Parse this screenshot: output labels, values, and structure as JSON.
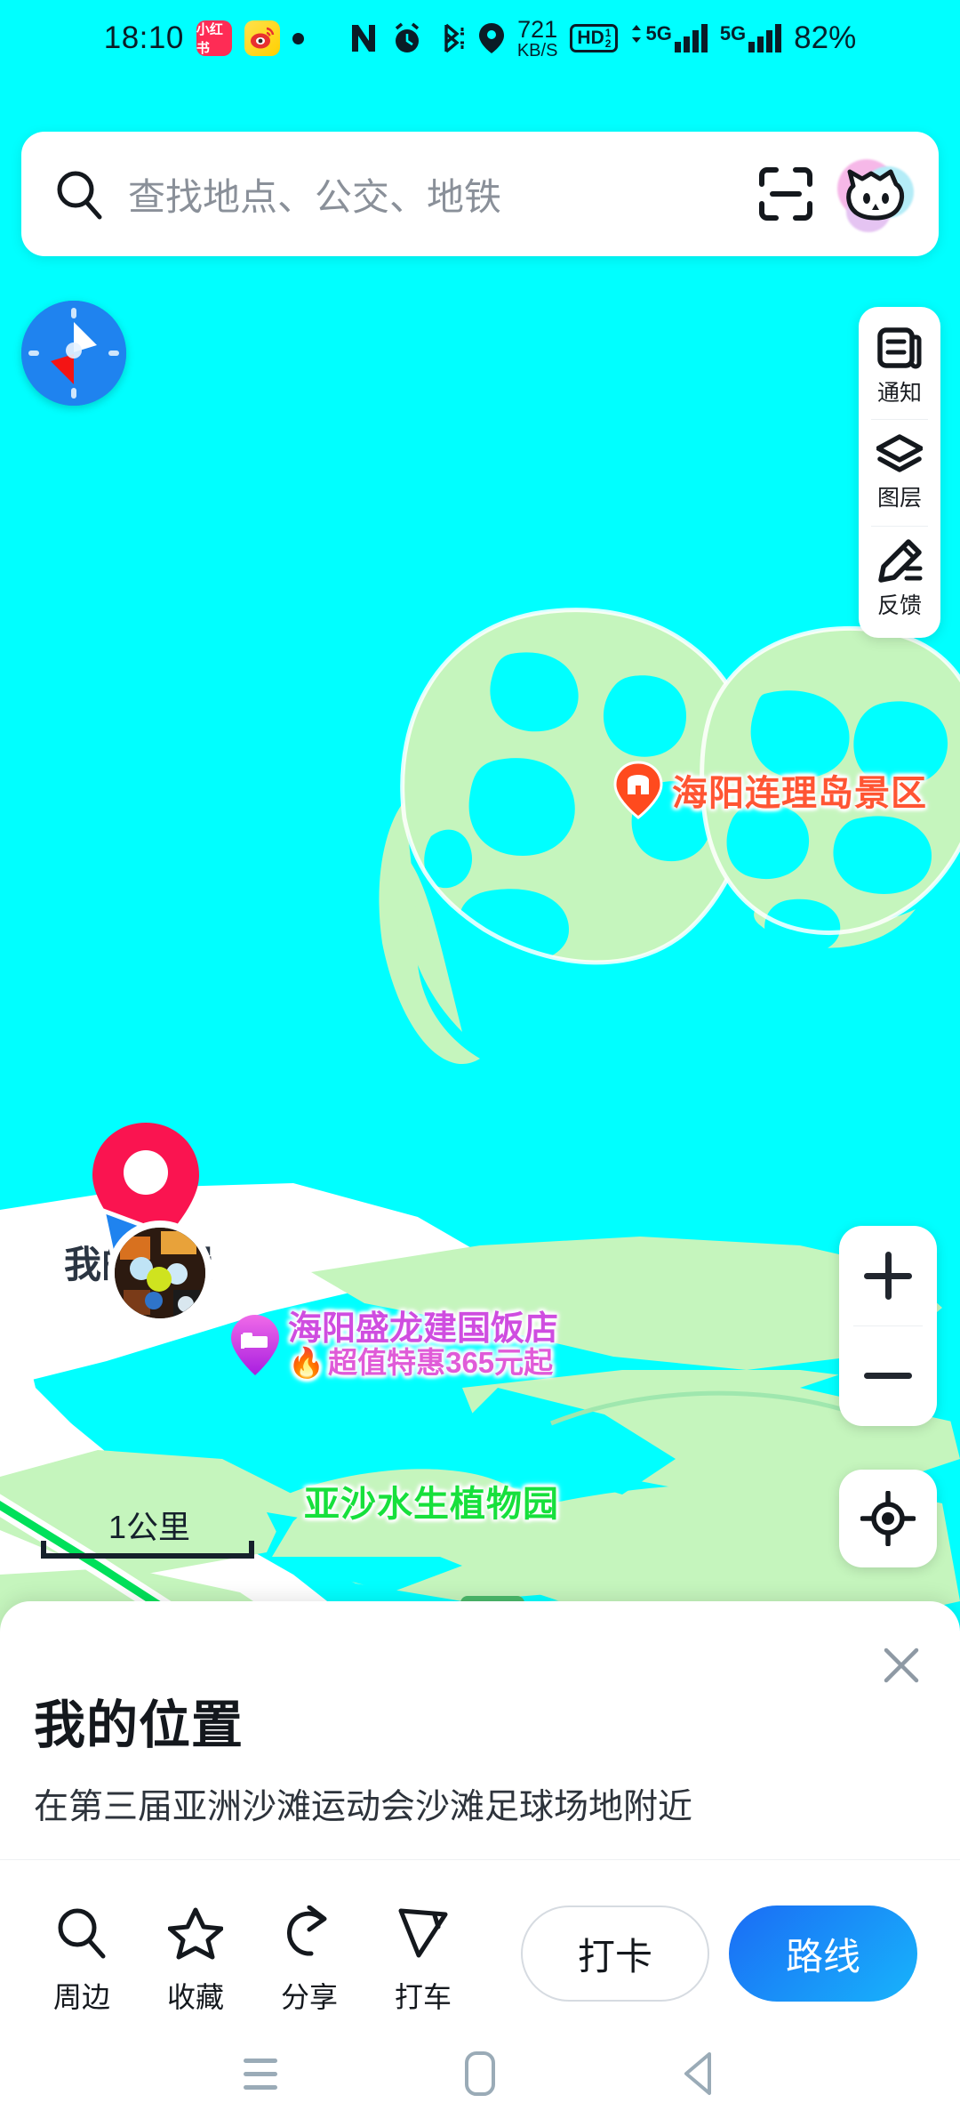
{
  "status_bar": {
    "time": "18:10",
    "app_icons": [
      {
        "name": "xiaohongshu-icon",
        "label": "小红书"
      },
      {
        "name": "weibo-icon",
        "label": "微博"
      }
    ],
    "indicators": [
      {
        "name": "nfc-icon",
        "label": "NFC"
      },
      {
        "name": "alarm-icon",
        "label": "闹钟"
      },
      {
        "name": "bluetooth-icon",
        "label": "蓝牙"
      },
      {
        "name": "location-icon",
        "label": "定位"
      }
    ],
    "network_speed_value": "721",
    "network_speed_unit": "KB/S",
    "hd_label": "HD",
    "hd_sup_top": "1",
    "hd_sup_bottom": "2",
    "sim1_network": "5G",
    "sim2_network": "5G",
    "battery": "82%"
  },
  "search": {
    "placeholder": "查找地点、公交、地铁",
    "value": "",
    "scan_icon": "scan-icon",
    "avatar_icon": "cat-avatar-icon"
  },
  "map": {
    "compass_icon": "compass-icon",
    "scale_label": "1公里",
    "labels": {
      "scenic_spot": "海阳连理岛景区",
      "park": "亚沙水生植物园",
      "hotel_name": "海阳盛龙建国饭店",
      "hotel_promo": "超值特惠365元起",
      "hotel_promo_icon": "fire-icon",
      "my_position": "我的位置"
    },
    "colors": {
      "water": "#00ffff",
      "land": "#c5f5bd",
      "road_green": "#00e05a",
      "road_white": "#ffffff",
      "scenic_label": "#ff5533",
      "park_label": "#17e03c",
      "hotel_label": "#cf4de0",
      "my_pin": "#fa1450"
    }
  },
  "tool_rail": [
    {
      "icon": "notification-icon",
      "label": "通知"
    },
    {
      "icon": "layers-icon",
      "label": "图层"
    },
    {
      "icon": "feedback-pencil-icon",
      "label": "反馈"
    }
  ],
  "zoom_control": {
    "zoom_in_icon": "plus-icon",
    "zoom_out_icon": "minus-icon",
    "locate_icon": "crosshair-locate-icon"
  },
  "sheet": {
    "title": "我的位置",
    "subtitle": "在第三届亚洲沙滩运动会沙滩足球场地附近",
    "close_icon": "close-icon",
    "actions": [
      {
        "icon": "search-nearby-icon",
        "label": "周边"
      },
      {
        "icon": "star-icon",
        "label": "收藏"
      },
      {
        "icon": "share-icon",
        "label": "分享"
      },
      {
        "icon": "taxi-cursor-icon",
        "label": "打车"
      }
    ],
    "checkin_label": "打卡",
    "route_label": "路线",
    "route_color": "#1a6cf5"
  },
  "nav_bar": [
    {
      "icon": "recents-icon",
      "label": "最近任务"
    },
    {
      "icon": "home-icon",
      "label": "主页"
    },
    {
      "icon": "back-icon",
      "label": "返回"
    }
  ]
}
